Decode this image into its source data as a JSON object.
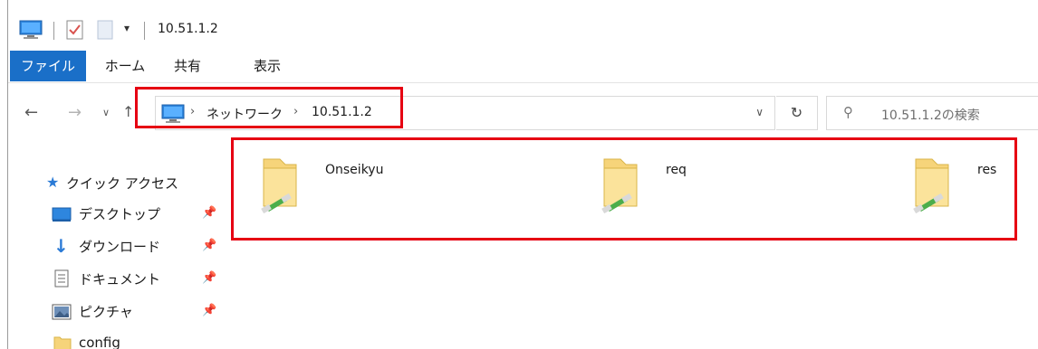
{
  "window": {
    "title": "10.51.1.2"
  },
  "ribbon": {
    "tabs": [
      "ファイル",
      "ホーム",
      "共有",
      "表示"
    ]
  },
  "address": {
    "crumbs": [
      "ネットワーク",
      "10.51.1.2"
    ],
    "search_placeholder": "10.51.1.2の検索"
  },
  "sidebar": {
    "quick_access": "クイック アクセス",
    "items": [
      {
        "label": "デスクトップ",
        "icon": "desktop-icon",
        "pinned": true
      },
      {
        "label": "ダウンロード",
        "icon": "download-icon",
        "pinned": true
      },
      {
        "label": "ドキュメント",
        "icon": "document-icon",
        "pinned": true
      },
      {
        "label": "ピクチャ",
        "icon": "picture-icon",
        "pinned": true
      },
      {
        "label": "config",
        "icon": "folder-icon",
        "pinned": false
      }
    ]
  },
  "content": {
    "items": [
      {
        "name": "Onseikyu",
        "icon": "network-share-folder-icon"
      },
      {
        "name": "req",
        "icon": "network-share-folder-icon"
      },
      {
        "name": "res",
        "icon": "network-share-folder-icon"
      }
    ]
  },
  "colors": {
    "highlight": "#e60012",
    "file_tab": "#1a6fc8",
    "quick_access_star": "#2a7ad6"
  }
}
